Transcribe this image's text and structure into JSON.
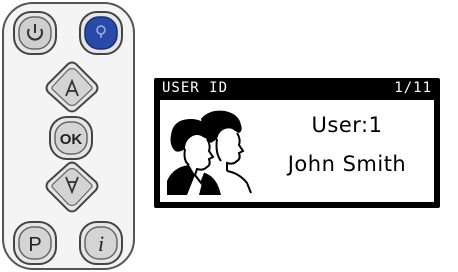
{
  "remote": {
    "buttons": {
      "power": {
        "icon": "power-icon"
      },
      "light": {
        "icon": "light-bulb-icon",
        "color": "#2a4aa8"
      },
      "up": {
        "icon": "arrow-up-icon"
      },
      "ok": {
        "label": "OK"
      },
      "down": {
        "icon": "arrow-down-icon"
      },
      "program": {
        "label": "P"
      },
      "info": {
        "label": "i"
      }
    },
    "body_color": "#f2f2f2",
    "button_color": "#dcdcdc"
  },
  "lcd": {
    "title": "USER ID",
    "page": "1/11",
    "user_label": "User:1",
    "user_name": "John Smith",
    "icon": "users-icon"
  }
}
